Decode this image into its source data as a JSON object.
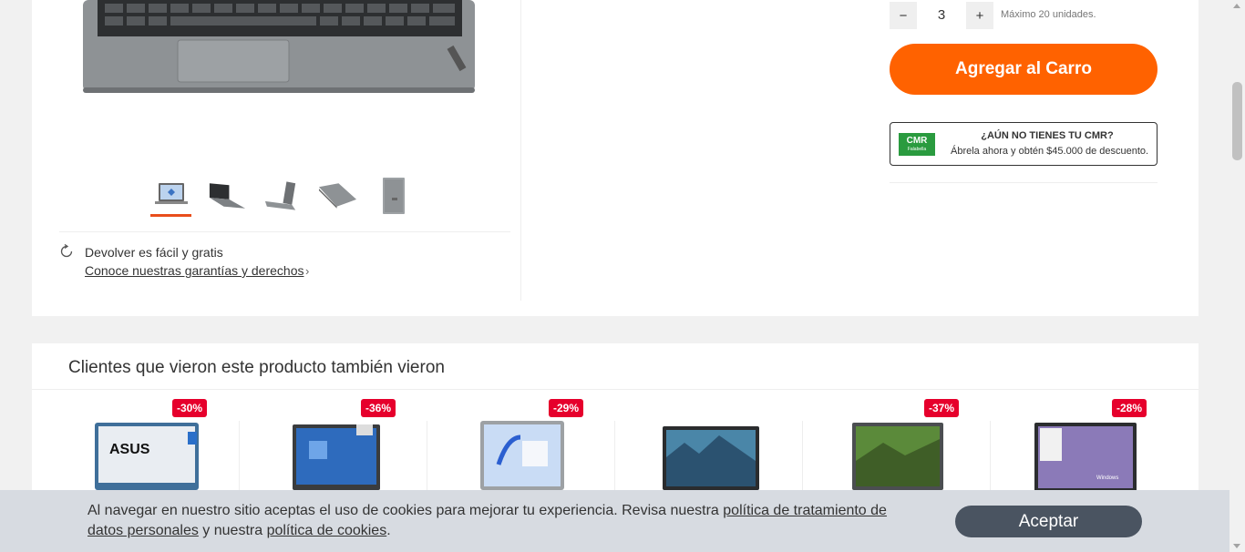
{
  "gallery": {
    "thumbnails": [
      "laptop-front-thumb",
      "laptop-angle-thumb",
      "laptop-side-thumb",
      "laptop-closed-thumb",
      "laptop-back-thumb"
    ],
    "active_thumbnail": 1,
    "return_title": "Devolver es fácil y gratis",
    "return_link": "Conoce nuestras garantías y derechos"
  },
  "buybox": {
    "quantity_minus": "−",
    "quantity_value": "3",
    "quantity_plus": "+",
    "quantity_max": "Máximo 20 unidades.",
    "add_to_cart": "Agregar al Carro",
    "cmr": {
      "logo_text": "CMR",
      "logo_sub": "Falabella",
      "title": "¿AÚN NO TIENES TU CMR?",
      "subtitle": "Ábrela ahora y obtén $45.000 de descuento."
    }
  },
  "recommendations": {
    "title": "Clientes que vieron este producto también vieron",
    "items": [
      {
        "discount": "-30%",
        "brand": "ASUS"
      },
      {
        "discount": "-36%",
        "brand": ""
      },
      {
        "discount": "-29%",
        "brand": ""
      },
      {
        "discount": "",
        "brand": ""
      },
      {
        "discount": "-37%",
        "brand": ""
      },
      {
        "discount": "-28%",
        "brand": "Windows"
      }
    ]
  },
  "cookie_banner": {
    "text_before": "Al navegar en nuestro sitio aceptas el uso de cookies para mejorar tu experiencia. Revisa nuestra ",
    "privacy_link": "política de tratamiento de datos personales",
    "text_middle": " y nuestra ",
    "cookies_link": "política de cookies",
    "text_after": ".",
    "accept_button": "Aceptar"
  },
  "colors": {
    "accent_orange": "#ff6200",
    "discount_red": "#e6002c",
    "cmr_green": "#2a9b3f",
    "cookie_button": "#4a5461"
  }
}
